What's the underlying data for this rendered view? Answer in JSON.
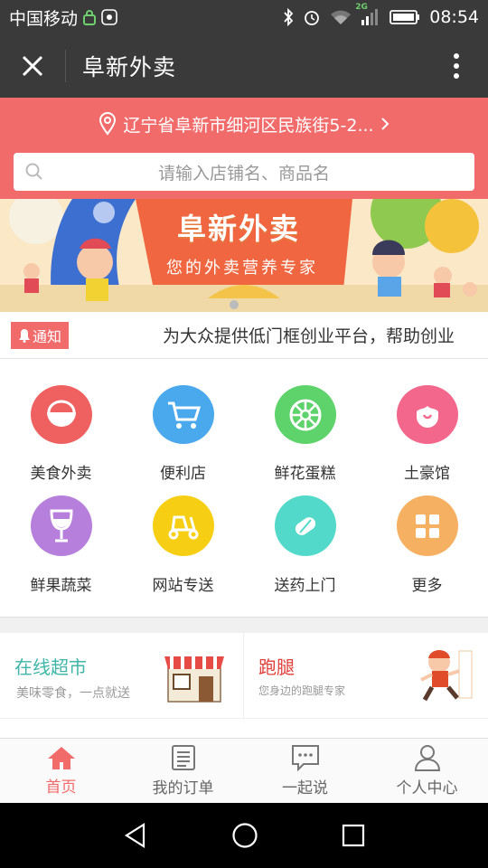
{
  "status_bar": {
    "carrier": "中国移动",
    "network": "2G",
    "time": "08:54"
  },
  "title_bar": {
    "title": "阜新外卖"
  },
  "location": {
    "address": "辽宁省阜新市细河区民族街5-2..."
  },
  "search": {
    "placeholder": "请输入店铺名、商品名"
  },
  "banner": {
    "title": "阜新外卖",
    "subtitle": "您的外卖营养专家"
  },
  "notice": {
    "tag": "通知",
    "text": "为大众提供低门框创业平台，帮助创业"
  },
  "categories": [
    {
      "label": "美食外卖",
      "color": "#ef6160",
      "icon": "bowl-icon"
    },
    {
      "label": "便利店",
      "color": "#4aa8ec",
      "icon": "cart-icon"
    },
    {
      "label": "鲜花蛋糕",
      "color": "#5fd36b",
      "icon": "flower-icon"
    },
    {
      "label": "土豪馆",
      "color": "#f2678b",
      "icon": "ring-icon"
    },
    {
      "label": "鲜果蔬菜",
      "color": "#b77fdc",
      "icon": "wine-glass-icon"
    },
    {
      "label": "网站专送",
      "color": "#f6cf14",
      "icon": "scooter-icon"
    },
    {
      "label": "送药上门",
      "color": "#52d9c9",
      "icon": "pill-icon"
    },
    {
      "label": "更多",
      "color": "#f6b062",
      "icon": "grid-icon"
    }
  ],
  "promos": {
    "supermarket": {
      "title": "在线超市",
      "subtitle": "美味零食，一点就送",
      "color": "#3fb6a8"
    },
    "errand": {
      "title": "跑腿",
      "subtitle": "您身边的跑腿专家",
      "color": "#e0403a"
    }
  },
  "tabs": [
    {
      "label": "首页",
      "icon": "home-icon",
      "active": true
    },
    {
      "label": "我的订单",
      "icon": "order-list-icon",
      "active": false
    },
    {
      "label": "一起说",
      "icon": "chat-icon",
      "active": false
    },
    {
      "label": "个人中心",
      "icon": "user-icon",
      "active": false
    }
  ],
  "colors": {
    "accent": "#f26b6b",
    "header_dark": "#3a3a3a"
  }
}
